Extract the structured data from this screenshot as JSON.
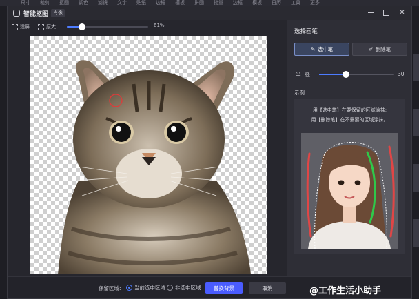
{
  "background_app": {
    "menu_items": [
      "尺寸",
      "裁剪",
      "抠图",
      "调色",
      "滤镜",
      "文字",
      "贴纸",
      "边框",
      "模板",
      "拼图",
      "批量",
      "边框",
      "模板",
      "日历",
      "工具",
      "更多"
    ]
  },
  "dialog": {
    "title": "智能抠图",
    "tag": "肖像"
  },
  "toolbar": {
    "restore_label": "适屏",
    "enlarge_label": "原大",
    "zoom_percent": 61,
    "zoom_display": "61%"
  },
  "bottombar": {
    "keep_area_label": "保留区域:",
    "option_selected": "当前选中区域",
    "option_unselected": "非选中区域",
    "replace_bg_label": "替换背景",
    "cancel_label": "取消"
  },
  "watermark": "@工作生活小助手",
  "panel": {
    "title": "选择画笔",
    "select_brush_label": "选中笔",
    "erase_brush_label": "删除笔",
    "radius_label": "半径",
    "radius_value": "30",
    "radius_fraction": 0.3,
    "example_label": "示例:",
    "example_line1": "用【选中笔】在要保留的区域涂抹;",
    "example_line2": "用【删除笔】在不需要的区域涂抹。"
  },
  "colors": {
    "accent": "#4d7cff",
    "primary_button": "#4a5cff",
    "brush_cursor": "#e03a3a",
    "keep_stroke": "#2fc84a",
    "erase_stroke": "#e04646"
  }
}
